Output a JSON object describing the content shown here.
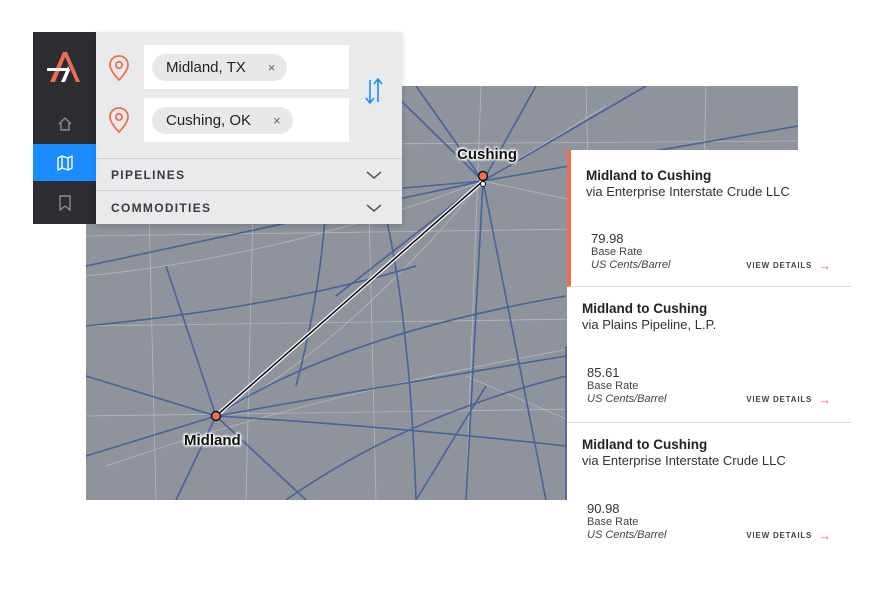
{
  "map": {
    "origin_label": "Midland",
    "destination_label": "Cushing"
  },
  "search": {
    "origin_chip": "Midland, TX",
    "destination_chip": "Cushing, OK",
    "remove_glyph": "×",
    "swap_icon": "swap-arrows-icon",
    "accordions": [
      {
        "label": "PIPELINES"
      },
      {
        "label": "COMMODITIES"
      }
    ]
  },
  "rail": {
    "items": [
      {
        "icon": "home-icon"
      },
      {
        "icon": "map-icon",
        "active": true
      },
      {
        "icon": "bookmark-icon"
      }
    ]
  },
  "results": [
    {
      "route": "Midland to Cushing",
      "via": "via Enterprise Interstate Crude LLC",
      "rate": "79.98",
      "rate_label": "Base Rate",
      "unit": "US Cents/Barrel",
      "action": "VIEW DETAILS",
      "selected": true
    },
    {
      "route": "Midland to Cushing",
      "via": "via Plains Pipeline, L.P.",
      "rate": "85.61",
      "rate_label": "Base Rate",
      "unit": "US Cents/Barrel",
      "action": "VIEW DETAILS",
      "selected": false
    },
    {
      "route": "Midland to Cushing",
      "via": "via Enterprise Interstate Crude LLC",
      "rate": "90.98",
      "rate_label": "Base Rate",
      "unit": "US Cents/Barrel",
      "action": "VIEW DETAILS",
      "selected": false
    }
  ],
  "colors": {
    "accent": "#f26d4f",
    "active_blue": "#1a8cff",
    "rail_bg": "#2b2d31",
    "map_bg": "#8e939c",
    "pipeline": "#3b5b9a"
  }
}
